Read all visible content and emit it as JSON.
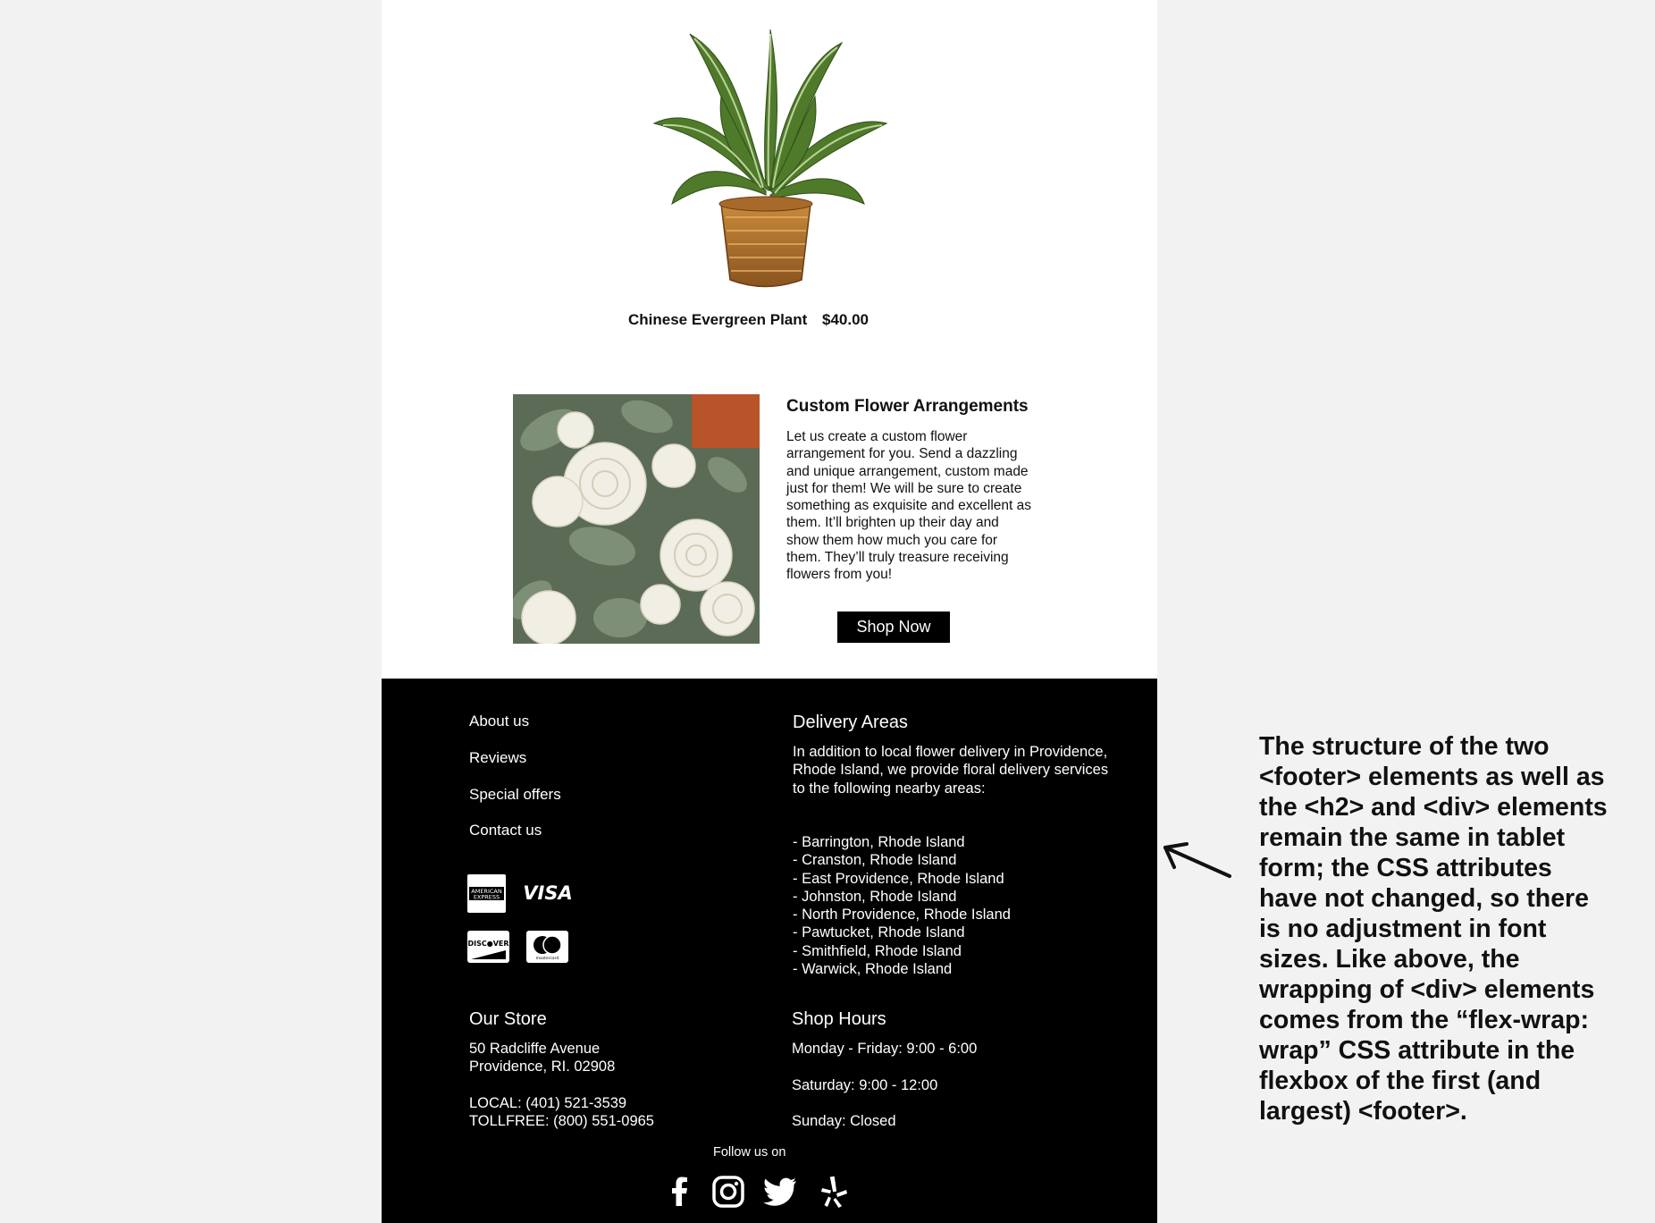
{
  "product": {
    "name": "Chinese Evergreen Plant",
    "price": "$40.00"
  },
  "custom": {
    "title": "Custom Flower Arrangements",
    "body": "Let us create a custom flower arrangement for you.  Send a dazzling and unique arrangement, custom made just for them! We will be sure to create something as exquisite and excellent as them. It’ll brighten up their day and show them how much you care for them. They’ll truly treasure receiving flowers from you!",
    "button": "Shop Now"
  },
  "footer": {
    "nav": [
      "About us",
      "Reviews",
      "Special offers",
      "Contact us"
    ],
    "payment_icons": [
      "american-express-icon",
      "visa-icon",
      "discover-icon",
      "mastercard-icon"
    ],
    "delivery": {
      "title": "Delivery Areas",
      "intro": "In addition to local flower delivery in Providence, Rhode Island, we provide floral delivery services to the following nearby areas:",
      "areas": [
        "- Barrington, Rhode Island",
        "- Cranston, Rhode Island",
        "- East Providence, Rhode Island",
        "- Johnston, Rhode Island",
        "- North Providence, Rhode Island",
        "- Pawtucket, Rhode Island",
        "- Smithfield, Rhode Island",
        "- Warwick, Rhode Island"
      ]
    },
    "store": {
      "title": "Our Store",
      "address1": "50 Radcliffe Avenue",
      "address2": "Providence, RI. 02908",
      "local": "LOCAL: (401) 521-3539",
      "tollfree": "TOLLFREE: (800) 551-0965"
    },
    "hours": {
      "title": "Shop Hours",
      "weekday": "Monday - Friday: 9:00 - 6:00",
      "saturday": "Saturday: 9:00 - 12:00",
      "sunday": "Sunday: Closed"
    },
    "follow": "Follow us on",
    "social_icons": [
      "facebook-icon",
      "instagram-icon",
      "twitter-icon",
      "yelp-icon"
    ]
  },
  "annotation": "The structure of the two <footer> elements as well as the <h2> and <div> elements remain the same in tablet form; the CSS attributes have not changed, so there is no adjustment in font sizes. Like above, the wrapping of <div> elements comes from the “flex-wrap: wrap” CSS attribute in the flexbox of the first (and largest) <footer>."
}
